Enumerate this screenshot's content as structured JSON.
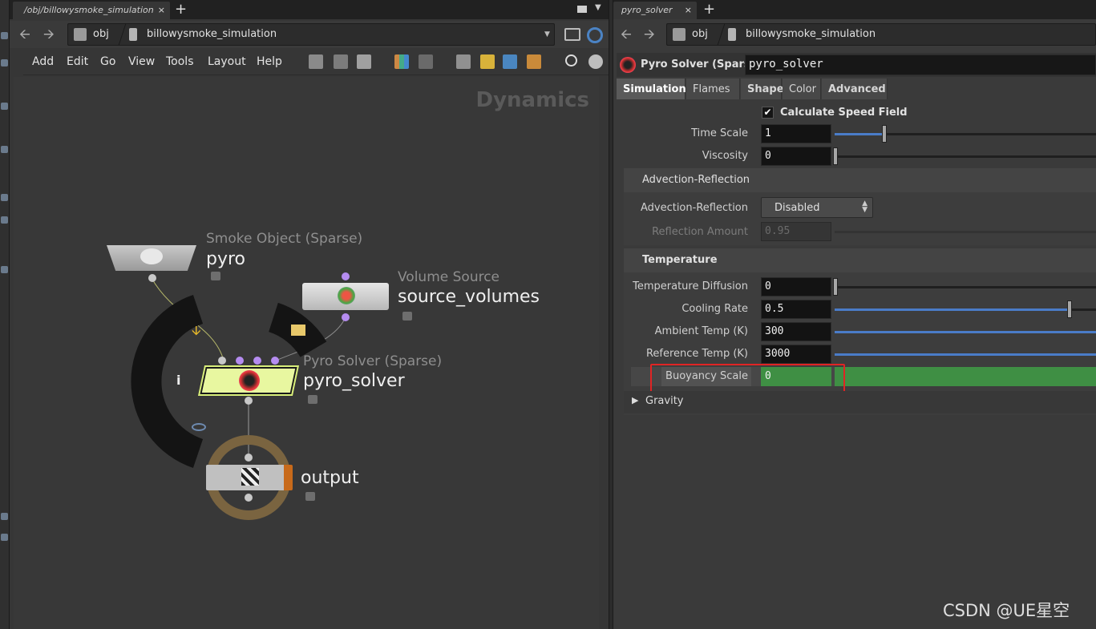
{
  "network": {
    "tab_path": "/obj/billowysmoke_simulation",
    "path": {
      "root": "obj",
      "current": "billowysmoke_simulation"
    },
    "menus": [
      "Add",
      "Edit",
      "Go",
      "View",
      "Tools",
      "Layout",
      "Help"
    ],
    "context_label": "Dynamics",
    "nodes": {
      "smoke": {
        "type": "Smoke Object (Sparse)",
        "name": "pyro"
      },
      "volume": {
        "type": "Volume Source",
        "name": "source_volumes"
      },
      "solver": {
        "type": "Pyro Solver (Sparse)",
        "name": "pyro_solver"
      },
      "output": {
        "name": "output"
      }
    },
    "ring_info": "i"
  },
  "params": {
    "tab": "pyro_solver",
    "path": {
      "root": "obj",
      "current": "billowysmoke_simulation"
    },
    "node_type": "Pyro Solver (Sparse)",
    "node_name": "pyro_solver",
    "tabs": [
      "Simulation",
      "Flames",
      "Shape",
      "Color",
      "Advanced"
    ],
    "active_tab": "Simulation",
    "calc_speed_label": "Calculate Speed Field",
    "time_scale": {
      "label": "Time Scale",
      "value": "1",
      "fraction": 0.19
    },
    "viscosity": {
      "label": "Viscosity",
      "value": "0",
      "fraction": 0
    },
    "advection_section": "Advection-Reflection",
    "advection": {
      "label": "Advection-Reflection",
      "value": "Disabled"
    },
    "reflection": {
      "label": "Reflection Amount",
      "value": "0.95"
    },
    "temp_section": "Temperature",
    "temp_diffusion": {
      "label": "Temperature Diffusion",
      "value": "0",
      "fraction": 0
    },
    "cooling": {
      "label": "Cooling Rate",
      "value": "0.5",
      "fraction": 0.9
    },
    "ambient": {
      "label": "Ambient Temp (K)",
      "value": "300"
    },
    "reference": {
      "label": "Reference Temp (K)",
      "value": "3000"
    },
    "buoyancy": {
      "label": "Buoyancy Scale",
      "value": "0"
    },
    "gravity_section": "Gravity"
  },
  "watermark": "CSDN @UE星空",
  "colors": {
    "highlight": "#e02424",
    "buoyancy_bar": "#3f8f44",
    "selected_node": "#e8f7a0"
  }
}
